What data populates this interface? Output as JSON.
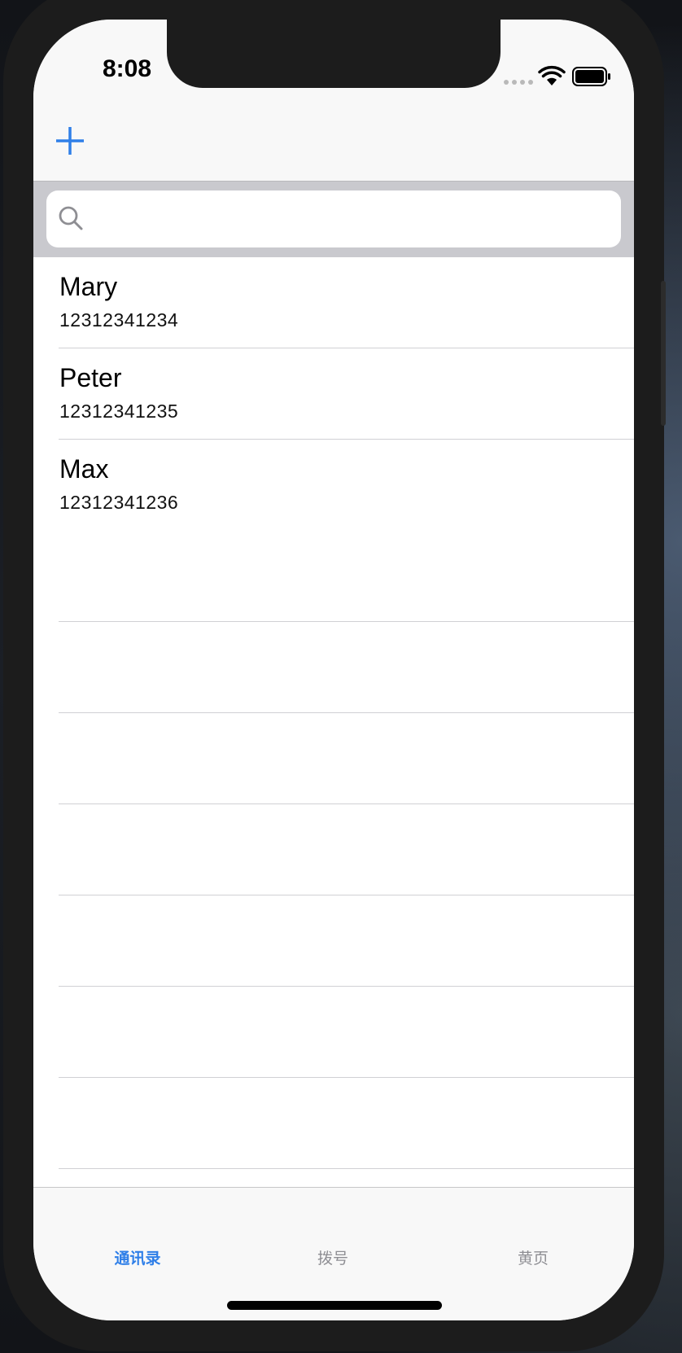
{
  "status_bar": {
    "time": "8:08"
  },
  "nav": {
    "add_icon": "plus-icon"
  },
  "search": {
    "placeholder": "",
    "value": "",
    "icon": "search-icon"
  },
  "contacts": [
    {
      "name": "Mary",
      "phone": "12312341234"
    },
    {
      "name": "Peter",
      "phone": "12312341235"
    },
    {
      "name": "Max",
      "phone": "12312341236"
    }
  ],
  "tabs": [
    {
      "label": "通讯录",
      "active": true
    },
    {
      "label": "拨号",
      "active": false
    },
    {
      "label": "黄页",
      "active": false
    }
  ],
  "colors": {
    "accent": "#2f7fe8",
    "inactive": "#8e8e93",
    "search_bg": "#c9c9ce"
  }
}
